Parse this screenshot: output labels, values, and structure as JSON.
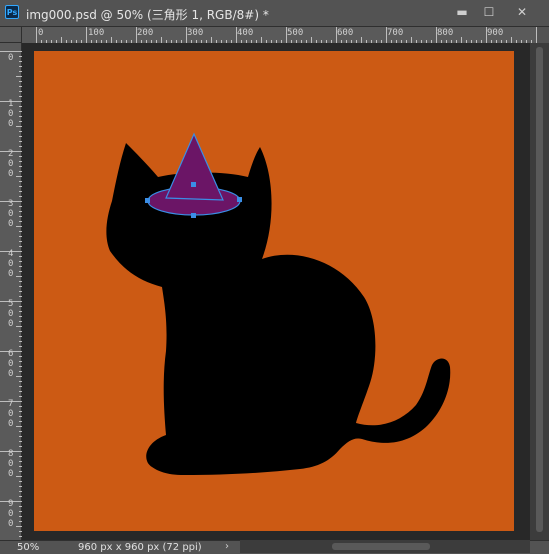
{
  "window": {
    "app_badge": "Ps",
    "title": "img000.psd @ 50% (三角形 1, RGB/8#) *",
    "minimize_glyph": "▬",
    "maximize_glyph": "☐",
    "close_glyph": "✕"
  },
  "ruler": {
    "top_labels": [
      "0",
      "100",
      "200",
      "300",
      "400",
      "500",
      "600",
      "700",
      "800",
      "900"
    ],
    "left_labels": [
      "0",
      "1 0 0",
      "2 0 0",
      "3 0 0",
      "4 0 0",
      "5 0 0",
      "6 0 0",
      "7 0 0",
      "8 0 0",
      "9 0 0"
    ]
  },
  "canvas": {
    "background_color": "#cc5a14",
    "cat_color": "#000000",
    "hat_fill": "#6b1566",
    "selection_color": "#3a8ee6",
    "selected_layer": "三角形 1"
  },
  "status": {
    "zoom": "50%",
    "doc_info": "960 px x 960 px (72 ppi)",
    "arrow": "›"
  }
}
